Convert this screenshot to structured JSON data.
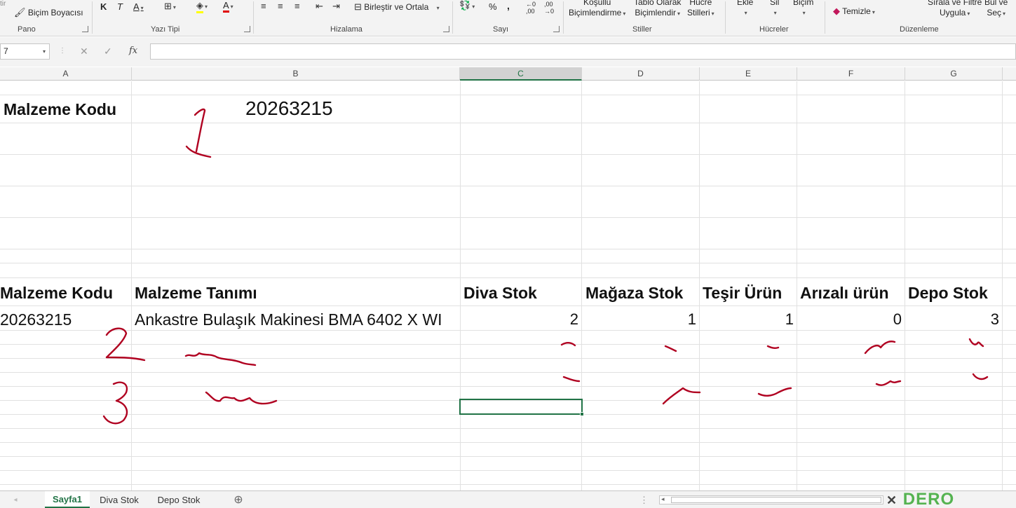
{
  "ribbon": {
    "format_painter": "Biçim Boyacısı",
    "bold": "K",
    "italic": "T",
    "underline": "A",
    "font_color": "A",
    "merge_center": "Birleştir ve Ortala",
    "percent": "%",
    "comma": ",",
    "conditional_line1": "Koşullu",
    "conditional_line2": "Biçimlendirme",
    "table_line1": "Tablo Olarak",
    "table_line2": "Biçimlendir",
    "styles_line1": "Hücre",
    "styles_line2": "Stilleri",
    "insert": "Ekle",
    "delete": "Sil",
    "format": "Biçim",
    "clear": "Temizle",
    "sort_line1": "Sırala ve Filtre",
    "sort_line2": "Uygula",
    "find_line1": "Bul ve",
    "find_line2": "Seç",
    "groups": {
      "clipboard": "Pano",
      "font": "Yazı Tipi",
      "alignment": "Hizalama",
      "number": "Sayı",
      "styles": "Stiller",
      "cells": "Hücreler",
      "editing": "Düzenleme"
    }
  },
  "formula_bar": {
    "name_box": "7",
    "cancel": "✕",
    "enter": "✓",
    "fx": "fx",
    "content": ""
  },
  "columns": [
    "A",
    "B",
    "C",
    "D",
    "E",
    "F",
    "G"
  ],
  "selected_column": "C",
  "sheet": {
    "top_label": "Malzeme Kodu",
    "top_value": "20263215",
    "headers": [
      "Malzeme Kodu",
      "Malzeme Tanımı",
      "Diva Stok",
      "Mağaza Stok",
      "Teşir Ürün",
      "Arızalı ürün",
      "Depo Stok"
    ],
    "row": {
      "code": "20263215",
      "description": "Ankastre Bulaşık Makinesi BMA 6402 X WI",
      "diva_stok": "2",
      "magaza_stok": "1",
      "teshir_urun": "1",
      "arizali_urun": "0",
      "depo_stok": "3"
    }
  },
  "tabs": [
    "Sayfa1",
    "Diva Stok",
    "Depo Stok"
  ],
  "active_tab": "Sayfa1",
  "watermark": "DERO",
  "colors": {
    "accent": "#217346",
    "ink": "#b00020",
    "grid": "#e1e1e1"
  }
}
